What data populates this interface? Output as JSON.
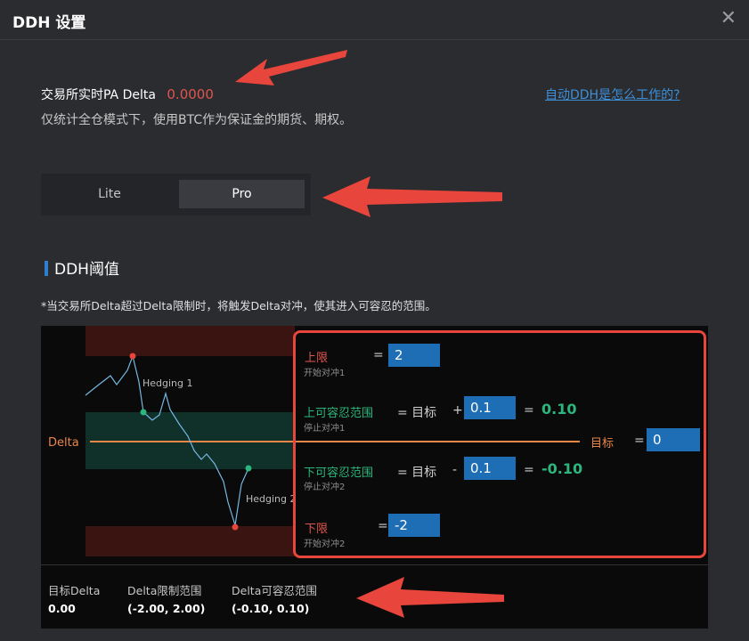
{
  "window": {
    "title": "DDH 设置",
    "close_glyph": "✕"
  },
  "header": {
    "pa_delta_label": "交易所实时PA Delta",
    "pa_delta_value": "0.0000",
    "help_link": "自动DDH是怎么工作的?",
    "description": "仅统计全仓模式下，使用BTC作为保证金的期货、期权。"
  },
  "mode_tabs": {
    "lite": "Lite",
    "pro": "Pro",
    "selected": "Pro"
  },
  "threshold": {
    "section_title": "DDH阈值",
    "note": "*当交易所Delta超过Delta限制时，将触发Delta对冲，使其进入可容忍的范围。"
  },
  "diagram": {
    "delta_label": "Delta",
    "hedging1": "Hedging 1",
    "hedging2": "Hedging 2"
  },
  "params": {
    "upper_limit": {
      "label": "上限",
      "sub": "开始对冲1",
      "eq": "=",
      "value": "2"
    },
    "upper_tolerance": {
      "label": "上可容忍范围",
      "sub": "停止对冲1",
      "eq": "= 目标",
      "op": "+",
      "value": "0.1",
      "result_eq": "=",
      "result": "0.10"
    },
    "target": {
      "label": "目标",
      "eq": "=",
      "value": "0"
    },
    "lower_tolerance": {
      "label": "下可容忍范围",
      "sub": "停止对冲2",
      "eq": "= 目标",
      "op": "-",
      "value": "0.1",
      "result_eq": "=",
      "result": "-0.10"
    },
    "lower_limit": {
      "label": "下限",
      "sub": "开始对冲2",
      "eq": "=",
      "value": "-2"
    }
  },
  "summary": {
    "target_delta": {
      "label": "目标Delta",
      "value": "0.00"
    },
    "delta_limit_range": {
      "label": "Delta限制范围",
      "value": "(-2.00, 2.00)"
    },
    "delta_tolerance_range": {
      "label": "Delta可容忍范围",
      "value": "(-0.10, 0.10)"
    }
  },
  "colors": {
    "background": "#2b2c30",
    "negative": "#e0554f",
    "positive": "#2cb67d",
    "input": "#1e6eb5",
    "accent_link": "#3d8fd8",
    "annotation_arrow": "#e8453c"
  }
}
